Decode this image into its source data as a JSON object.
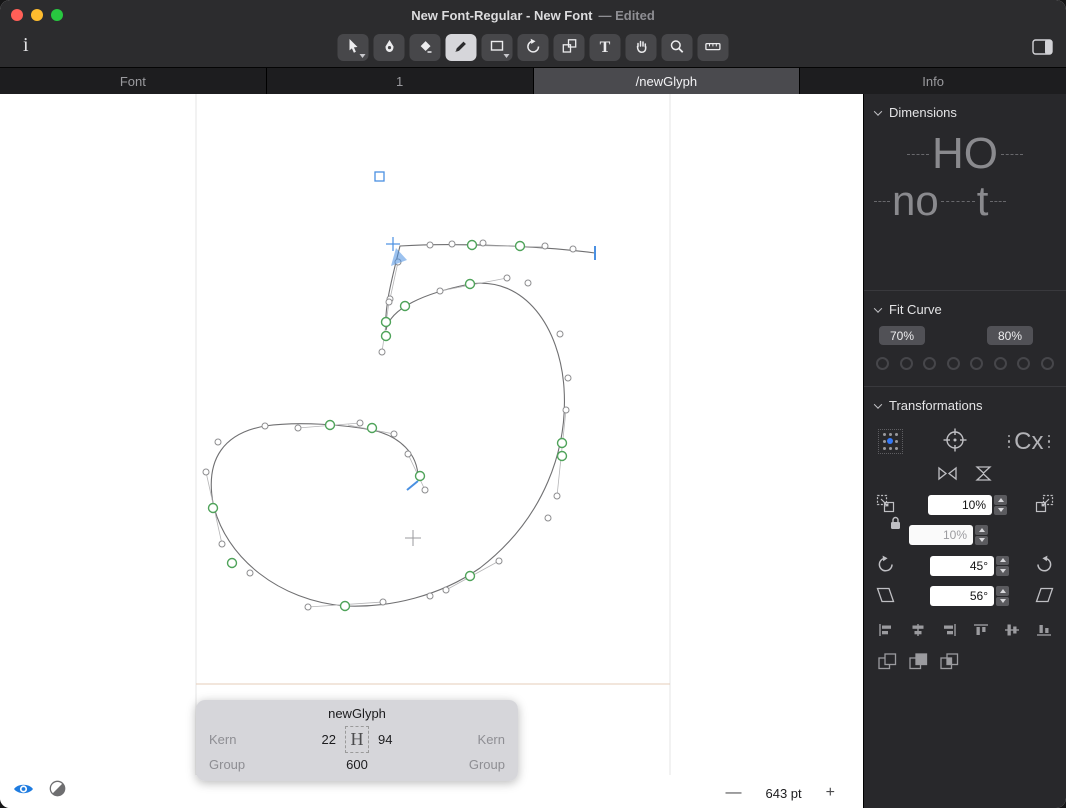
{
  "window": {
    "title": "New Font-Regular - New Font",
    "edited_suffix": "—  Edited"
  },
  "titlebar": {
    "info_icon": "i"
  },
  "toolbar": {
    "text_tool_label": "T",
    "tools": [
      "select-tool",
      "draw-tool",
      "erase-tool",
      "pencil-tool",
      "shape-tool",
      "rotate-tool",
      "scale-tool",
      "text-tool",
      "hand-tool",
      "zoom-tool",
      "measure-tool"
    ],
    "active_tool": "pencil-tool"
  },
  "tabs": {
    "font": "Font",
    "layer": "1",
    "glyph": "/newGlyph",
    "info": "Info"
  },
  "sidebar": {
    "dimensions": {
      "title": "Dimensions",
      "sample_caps": "HO",
      "sample_lower": "no",
      "sample_t": "t"
    },
    "fit_curve": {
      "title": "Fit Curve",
      "min": "70%",
      "max": "80%"
    },
    "transformations": {
      "title": "Transformations",
      "reference": "Cx",
      "scale_x": "10%",
      "scale_y": "10%",
      "rotation": "45°",
      "slant": "56°"
    }
  },
  "glyph_panel": {
    "name": "newGlyph",
    "kern_left": "Kern",
    "kern_right": "Kern",
    "group_left": "Group",
    "group_right": "Group",
    "lsb": "22",
    "rsb": "94",
    "sample": "H",
    "width": "600"
  },
  "statusbar": {
    "zoom_out": "—",
    "zoom_value": "643 pt",
    "zoom_in": "+"
  }
}
